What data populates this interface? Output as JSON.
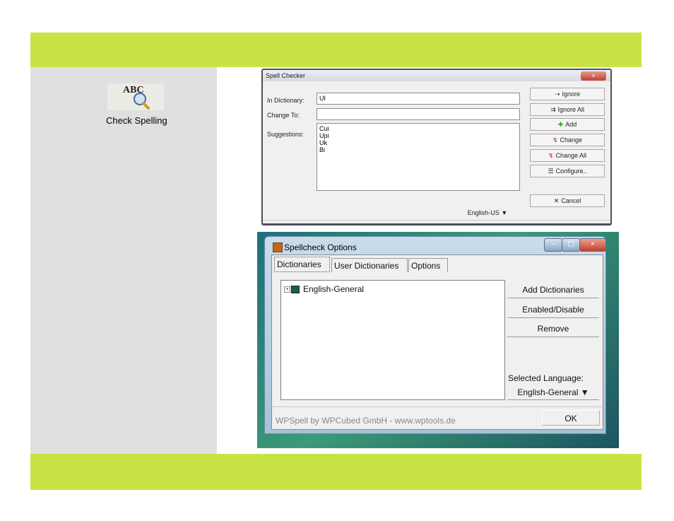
{
  "colors": {
    "band": "#c8e345",
    "left_panel": "#e0e0e0"
  },
  "left": {
    "icon": "abc-magnifier-icon",
    "label": "Check Spelling"
  },
  "spell_checker": {
    "title": "Spell Checker",
    "close_glyph": "×",
    "in_dictionary_label": "In Dictionary:",
    "in_dictionary_value": "UI",
    "change_to_label": "Change To:",
    "change_to_value": "",
    "suggestions_label": "Suggestions:",
    "suggestions": [
      "Cui",
      "Upi",
      "Uk",
      "Bi"
    ],
    "buttons": {
      "ignore": "Ignore",
      "ignore_all": "Ignore All",
      "add": "Add",
      "change": "Change",
      "change_all": "Change All",
      "configure": "Configure..",
      "cancel": "Cancel"
    },
    "language": "English-US"
  },
  "spellcheck_options": {
    "title": "Spellcheck Options",
    "window_buttons": {
      "minimize": "–",
      "maximize": "▢",
      "close": "×"
    },
    "tabs": [
      "Dictionaries",
      "User Dictionaries",
      "Options"
    ],
    "active_tab": "Dictionaries",
    "tree_items": [
      "English-General"
    ],
    "buttons": {
      "add": "Add Dictionaries",
      "enable": "Enabled/Disable",
      "remove": "Remove",
      "ok": "OK"
    },
    "selected_language_label": "Selected Language:",
    "selected_language": "English-General",
    "credit": "WPSpell by WPCubed GmbH - www.wptools.de"
  }
}
